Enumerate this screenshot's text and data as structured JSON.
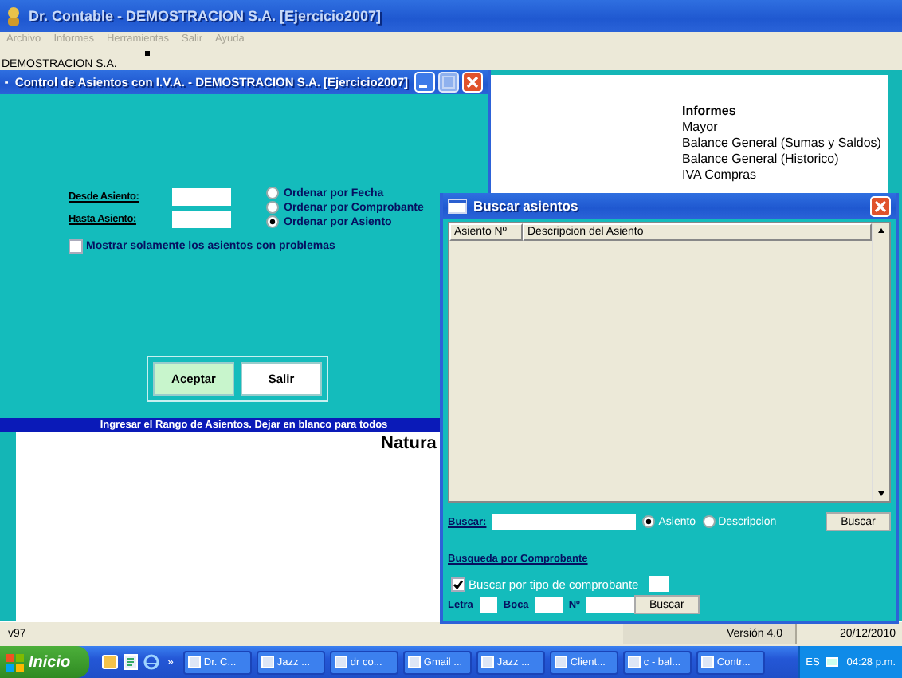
{
  "app": {
    "title": "Dr. Contable - DEMOSTRACION S.A.  [Ejercicio2007]",
    "menu": [
      {
        "label": "Archivo",
        "disabled": true
      },
      {
        "label": "Informes",
        "disabled": true
      },
      {
        "label": "Herramientas",
        "disabled": true
      },
      {
        "label": "Salir",
        "disabled": true
      },
      {
        "label": "Ayuda",
        "disabled": true
      }
    ],
    "company": "DEMOSTRACION S.A.",
    "reports": {
      "heading": "Informes",
      "items": [
        "Mayor",
        "Balance General (Sumas y Saldos)",
        "Balance General (Historico)",
        "IVA Compras"
      ]
    },
    "background_text": "Natura",
    "status_bar": {
      "build": "v97",
      "version": "Versión 4.0",
      "date": "20/12/2010"
    }
  },
  "control_window": {
    "title": "Control de Asientos con I.V.A.  - DEMOSTRACION S.A.  [Ejercicio2007]",
    "fields": [
      {
        "label": "Desde Asiento:"
      },
      {
        "label": "Hasta Asiento:"
      }
    ],
    "order_options": [
      {
        "label": "Ordenar por Fecha",
        "selected": false
      },
      {
        "label": "Ordenar por Comprobante",
        "selected": false
      },
      {
        "label": "Ordenar por Asiento",
        "selected": true
      }
    ],
    "only_problems": {
      "label": "Mostrar solamente los asientos con problemas",
      "checked": false
    },
    "buttons": [
      {
        "label": "Aceptar",
        "default": true
      },
      {
        "label": "Salir",
        "default": false
      }
    ],
    "hint": "Ingresar el Rango de Asientos. Dejar en blanco para todos"
  },
  "search_window": {
    "title": "Buscar asientos",
    "table": {
      "columns": [
        "Asiento Nº",
        "Descripcion del Asiento"
      ]
    },
    "search": {
      "label": "Buscar:",
      "options": [
        {
          "label": "Asiento",
          "selected": true
        },
        {
          "label": "Descripcion",
          "selected": false
        }
      ],
      "button": "Buscar"
    },
    "section": "Busqueda por Comprobante",
    "by_type": {
      "label": "Buscar por tipo de comprobante",
      "checked": true
    },
    "voucher_fields": [
      {
        "label": "Letra"
      },
      {
        "label": "Boca"
      },
      {
        "label": "Nº"
      }
    ],
    "voucher_button": "Buscar"
  },
  "taskbar": {
    "start": "Inicio",
    "more": "»",
    "tasks": [
      "Dr. C...",
      "Jazz ...",
      "dr co...",
      "Gmail ...",
      "Jazz ...",
      "Client...",
      "c - bal...",
      "Contr..."
    ],
    "language": "ES",
    "clock": "04:28 p.m."
  }
}
